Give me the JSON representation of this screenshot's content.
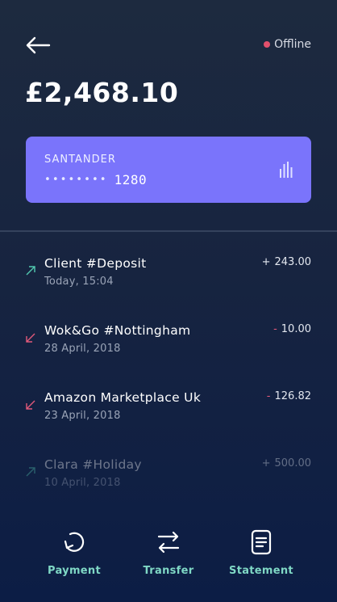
{
  "colors": {
    "accent": "#7a74fb",
    "positive": "#52c9b0",
    "negative": "#e2597a",
    "offline_dot": "#e2506c",
    "nav_label": "#7fd8c5"
  },
  "header": {
    "back_icon": "arrow-left-icon",
    "status_label": "Offline",
    "balance": "£2,468.10"
  },
  "card": {
    "bank": "SANTANDER",
    "masked_digits": "••••••••",
    "last4": "1280",
    "icon": "bar-chart-icon"
  },
  "transactions": [
    {
      "name": "Client #Deposit",
      "date": "Today, 15:04",
      "sign": "+",
      "amount": "243.00",
      "direction": "in"
    },
    {
      "name": "Wok&Go #Nottingham",
      "date": "28 April, 2018",
      "sign": "-",
      "amount": "10.00",
      "direction": "out"
    },
    {
      "name": "Amazon Marketplace Uk",
      "date": "23 April, 2018",
      "sign": "-",
      "amount": "126.82",
      "direction": "out"
    },
    {
      "name": "Clara #Holiday",
      "date": "10 April, 2018",
      "sign": "+",
      "amount": "500.00",
      "direction": "in"
    }
  ],
  "nav": {
    "payment": "Payment",
    "transfer": "Transfer",
    "statement": "Statement"
  }
}
